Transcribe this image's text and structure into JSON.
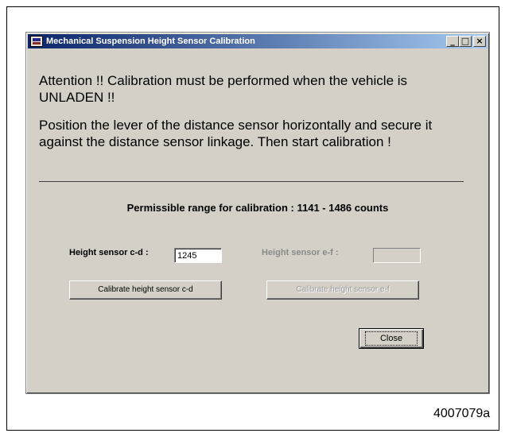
{
  "window": {
    "title": "Mechanical Suspension Height Sensor Calibration",
    "controls": {
      "minimize": "_",
      "maximize": "□",
      "close": "×"
    }
  },
  "messages": {
    "attention": "Attention !!  Calibration must be performed when the vehicle is UNLADEN !!",
    "instruction": "Position the lever of the distance sensor horizontally and secure it against the distance sensor linkage.  Then start calibration !"
  },
  "range_text": "Permissible range for calibration : 1141 - 1486  counts",
  "sensor_cd": {
    "label": "Height sensor c-d :",
    "value": "1245",
    "button": "Calibrate height sensor c-d"
  },
  "sensor_ef": {
    "label": "Height sensor e-f :",
    "value": "",
    "button": "Calibrate height sensor e-f"
  },
  "close_button": "Close",
  "figure_id": "4007079a"
}
